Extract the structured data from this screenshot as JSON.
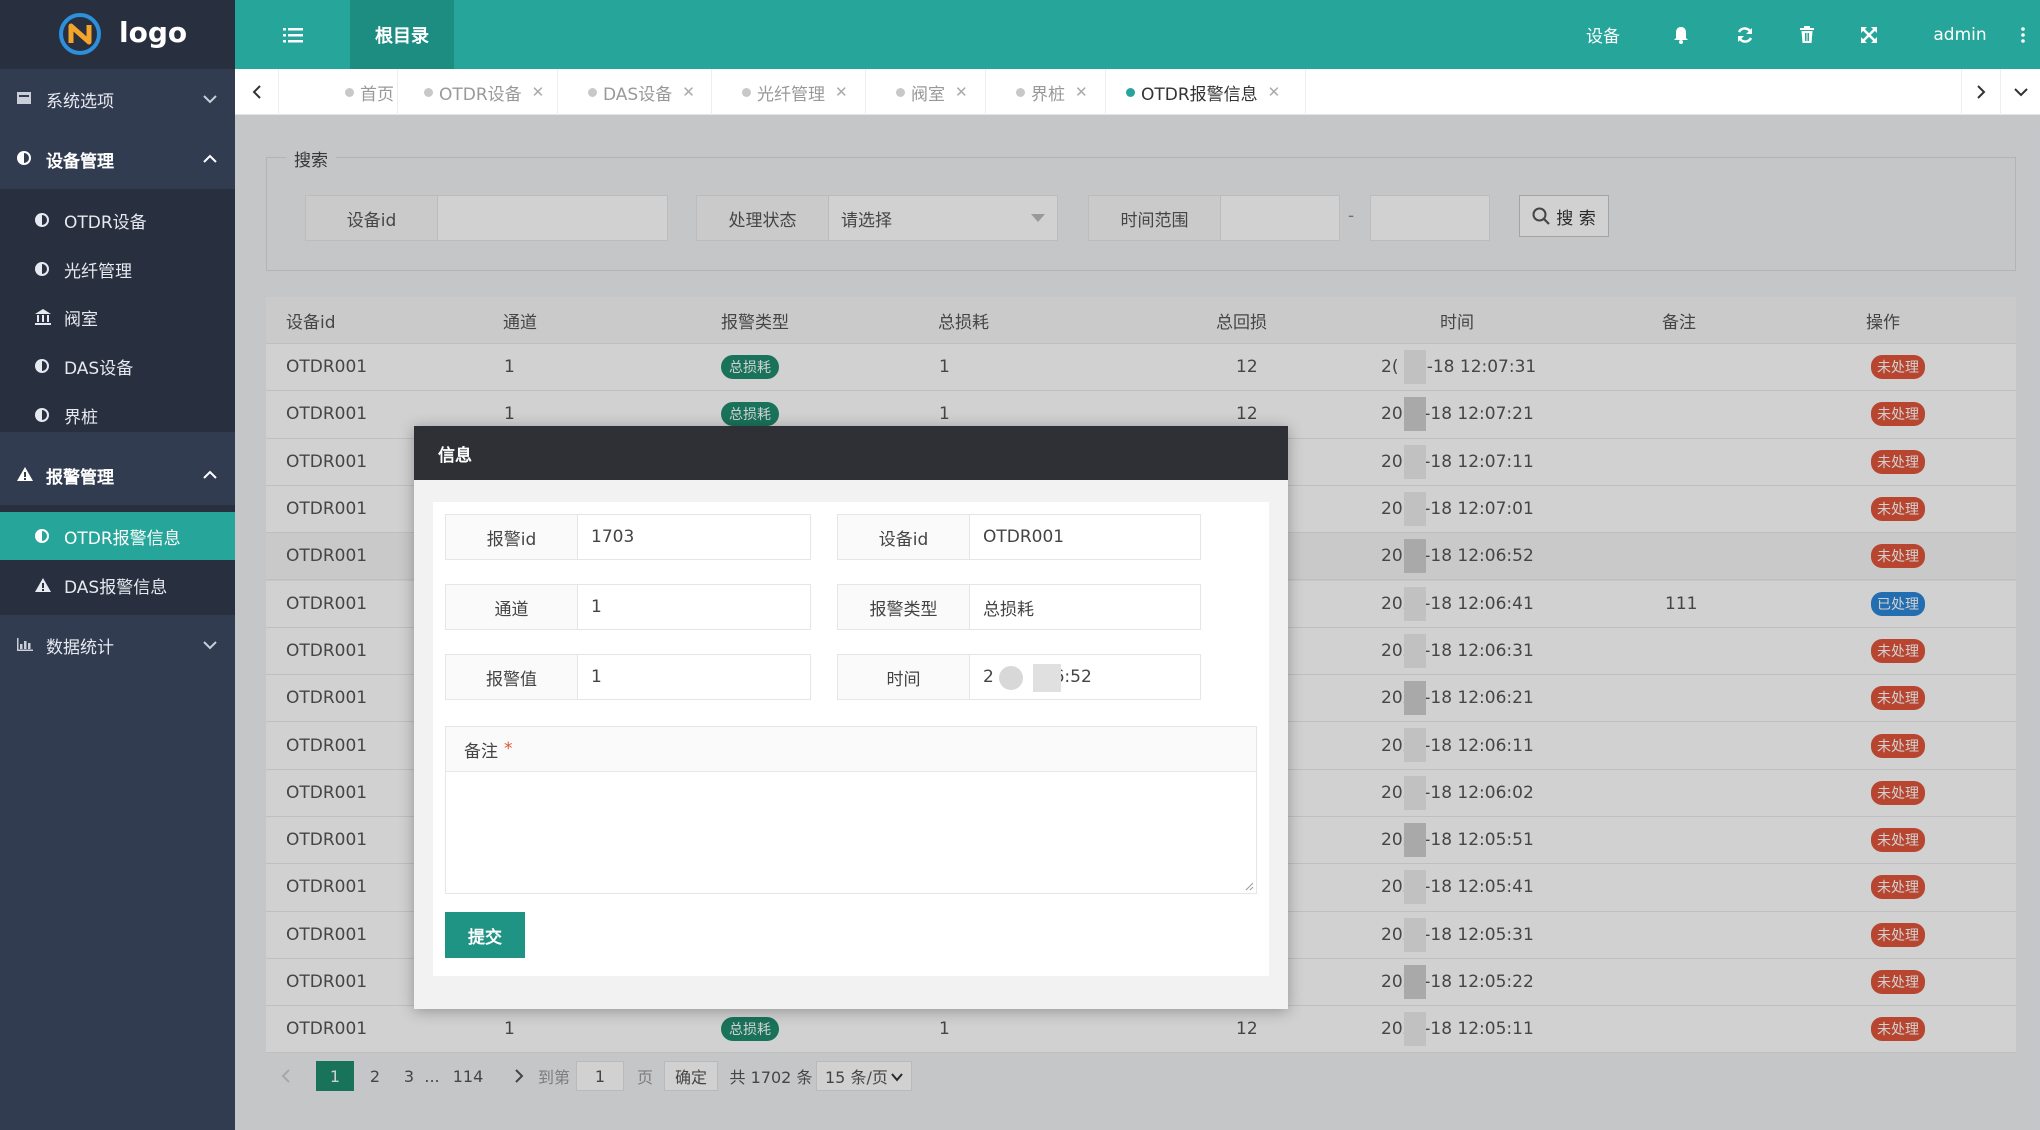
{
  "logo": {
    "text": "logo"
  },
  "sidebar": {
    "groups": [
      {
        "label": "系统选项",
        "icon": "card-icon",
        "expanded": false
      },
      {
        "label": "设备管理",
        "icon": "half-circle-icon",
        "expanded": true,
        "items": [
          {
            "label": "OTDR设备",
            "icon": "half-circle-icon"
          },
          {
            "label": "光纤管理",
            "icon": "half-circle-icon"
          },
          {
            "label": "阀室",
            "icon": "bank-icon"
          },
          {
            "label": "DAS设备",
            "icon": "half-circle-icon"
          },
          {
            "label": "界桩",
            "icon": "half-circle-icon"
          }
        ]
      },
      {
        "label": "报警管理",
        "icon": "warning-icon",
        "expanded": true,
        "items": [
          {
            "label": "OTDR报警信息",
            "icon": "half-circle-icon",
            "active": true
          },
          {
            "label": "DAS报警信息",
            "icon": "warning-icon"
          }
        ]
      },
      {
        "label": "数据统计",
        "icon": "bar-chart-icon",
        "expanded": false
      }
    ]
  },
  "header": {
    "root_tab": "根目录",
    "device_link": "设备",
    "user": "admin"
  },
  "tabs": [
    {
      "label": "首页",
      "closable": false
    },
    {
      "label": "OTDR设备",
      "closable": true
    },
    {
      "label": "DAS设备",
      "closable": true
    },
    {
      "label": "光纤管理",
      "closable": true
    },
    {
      "label": "阀室",
      "closable": true
    },
    {
      "label": "界桩",
      "closable": true
    },
    {
      "label": "OTDR报警信息",
      "closable": true,
      "active": true
    }
  ],
  "search": {
    "legend": "搜索",
    "device_id_label": "设备id",
    "device_id_value": "",
    "status_label": "处理状态",
    "status_placeholder": "请选择",
    "time_label": "时间范围",
    "time_separator": "-",
    "button": "搜 索"
  },
  "table": {
    "columns": [
      "设备id",
      "通道",
      "报警类型",
      "总损耗",
      "总回损",
      "时间",
      "备注",
      "操作"
    ],
    "rows": [
      {
        "device": "OTDR001",
        "channel": "1",
        "type": "总损耗",
        "loss": "1",
        "return_loss": "12",
        "time": "2(  )5-18 12:07:31",
        "remark": "",
        "status": "未处理"
      },
      {
        "device": "OTDR001",
        "channel": "1",
        "type": "总损耗",
        "loss": "1",
        "return_loss": "12",
        "time": "20  5-18 12:07:21",
        "remark": "",
        "status": "未处理"
      },
      {
        "device": "OTDR001",
        "channel": "",
        "type": "",
        "loss": "",
        "return_loss": "",
        "time": "20  5-18 12:07:11",
        "remark": "",
        "status": "未处理"
      },
      {
        "device": "OTDR001",
        "channel": "",
        "type": "",
        "loss": "",
        "return_loss": "",
        "time": "20  5-18 12:07:01",
        "remark": "",
        "status": "未处理"
      },
      {
        "device": "OTDR001",
        "channel": "",
        "type": "",
        "loss": "",
        "return_loss": "",
        "time": "20  5-18 12:06:52",
        "remark": "",
        "status": "未处理"
      },
      {
        "device": "OTDR001",
        "channel": "",
        "type": "",
        "loss": "",
        "return_loss": "",
        "time": "202  -18 12:06:41",
        "remark": "111",
        "status": "已处理"
      },
      {
        "device": "OTDR001",
        "channel": "",
        "type": "",
        "loss": "",
        "return_loss": "",
        "time": "202  -18 12:06:31",
        "remark": "",
        "status": "未处理"
      },
      {
        "device": "OTDR001",
        "channel": "",
        "type": "",
        "loss": "",
        "return_loss": "",
        "time": "202  -18 12:06:21",
        "remark": "",
        "status": "未处理"
      },
      {
        "device": "OTDR001",
        "channel": "",
        "type": "",
        "loss": "",
        "return_loss": "",
        "time": "202  -18 12:06:11",
        "remark": "",
        "status": "未处理"
      },
      {
        "device": "OTDR001",
        "channel": "",
        "type": "",
        "loss": "",
        "return_loss": "",
        "time": "202  -18 12:06:02",
        "remark": "",
        "status": "未处理"
      },
      {
        "device": "OTDR001",
        "channel": "",
        "type": "",
        "loss": "",
        "return_loss": "",
        "time": "202  -18 12:05:51",
        "remark": "",
        "status": "未处理"
      },
      {
        "device": "OTDR001",
        "channel": "",
        "type": "",
        "loss": "",
        "return_loss": "",
        "time": "202  -18 12:05:41",
        "remark": "",
        "status": "未处理"
      },
      {
        "device": "OTDR001",
        "channel": "",
        "type": "",
        "loss": "",
        "return_loss": "",
        "time": "202  -18 12:05:31",
        "remark": "",
        "status": "未处理"
      },
      {
        "device": "OTDR001",
        "channel": "",
        "type": "",
        "loss": "",
        "return_loss": "",
        "time": "202  -18 12:05:22",
        "remark": "",
        "status": "未处理"
      },
      {
        "device": "OTDR001",
        "channel": "1",
        "type": "总损耗",
        "loss": "1",
        "return_loss": "12",
        "time": "202  -18 12:05:11",
        "remark": "",
        "status": "未处理"
      }
    ]
  },
  "pagination": {
    "pages": [
      "1",
      "2",
      "3"
    ],
    "ellipsis": "...",
    "last": "114",
    "goto_label": "到第",
    "goto_value": "1",
    "page_unit": "页",
    "confirm": "确定",
    "total": "共 1702 条",
    "per_page": "15 条/页"
  },
  "modal": {
    "title": "信息",
    "alarm_id_label": "报警id",
    "alarm_id": "1703",
    "device_id_label": "设备id",
    "device_id": "OTDR001",
    "channel_label": "通道",
    "channel": "1",
    "alarm_type_label": "报警类型",
    "alarm_type": "总损耗",
    "alarm_value_label": "报警值",
    "alarm_value": "1",
    "time_label": "时间",
    "time": "2        :06:52",
    "remark_label": "备注",
    "required_mark": "*",
    "submit": "提交"
  },
  "colors": {
    "primary": "#26a69a",
    "sidebar": "#323c50",
    "danger": "#e0553a",
    "info": "#2b86d8"
  }
}
